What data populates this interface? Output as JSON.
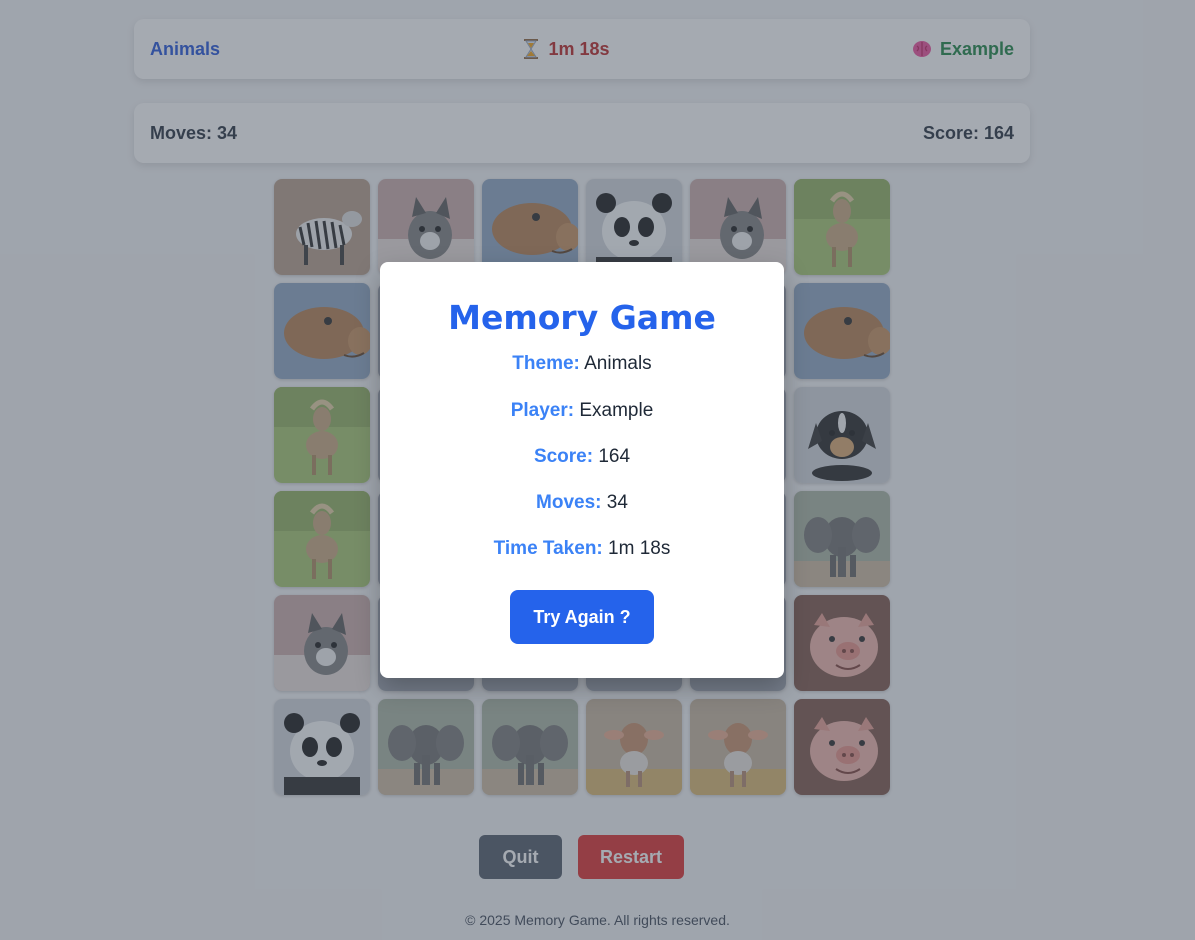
{
  "header": {
    "theme": "Animals",
    "timer": "1m 18s",
    "player": "Example",
    "hourglass_icon": "hourglass-icon",
    "brain_icon": "brain-icon"
  },
  "stats": {
    "moves": "Moves: 34",
    "score": "Score: 164"
  },
  "cards": [
    [
      "zebra",
      "cat",
      "camel",
      "panda",
      "cat",
      "pony"
    ],
    [
      "camel",
      "hidden",
      "hidden",
      "hidden",
      "hidden",
      "camel"
    ],
    [
      "pony",
      "hidden",
      "hidden",
      "hidden",
      "hidden",
      "puppy"
    ],
    [
      "pony",
      "hidden",
      "hidden",
      "hidden",
      "hidden",
      "elephant"
    ],
    [
      "cat",
      "hidden",
      "hidden",
      "hidden",
      "hidden",
      "pig"
    ],
    [
      "panda",
      "elephant",
      "elephant",
      "calf",
      "calf",
      "pig"
    ]
  ],
  "buttons": {
    "quit": "Quit",
    "restart": "Restart"
  },
  "footer": "© 2025 Memory Game. All rights reserved.",
  "modal": {
    "title": "Memory Game",
    "theme_label": "Theme:",
    "theme_value": "Animals",
    "player_label": "Player:",
    "player_value": "Example",
    "score_label": "Score:",
    "score_value": "164",
    "moves_label": "Moves:",
    "moves_value": "34",
    "time_label": "Time Taken:",
    "time_value": "1m 18s",
    "try_again": "Try Again ?"
  },
  "colors": {
    "primary": "#2563eb",
    "danger": "#dc2626",
    "success": "#15803d",
    "neutral": "#4b5563"
  }
}
